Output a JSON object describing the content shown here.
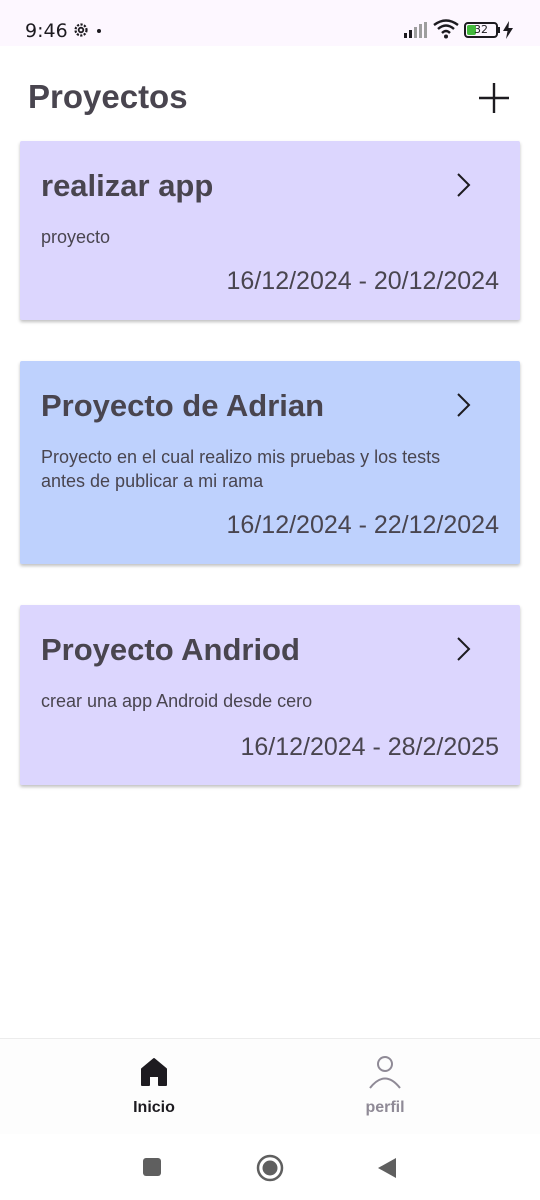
{
  "status_bar": {
    "time": "9:46",
    "battery_level": "32",
    "battery_color": "#43b93c"
  },
  "header": {
    "title": "Proyectos",
    "add_icon": "plus-icon"
  },
  "projects": [
    {
      "title": "realizar app",
      "description": "proyecto",
      "dates": "16/12/2024 - 20/12/2024",
      "color": "#dcd6fe"
    },
    {
      "title": "Proyecto de Adrian",
      "description": "Proyecto en el cual realizo mis pruebas y los tests antes de publicar a mi rama",
      "dates": "16/12/2024 - 22/12/2024",
      "color": "#bed1fd"
    },
    {
      "title": "Proyecto Andriod",
      "description": "crear una app Android desde cero",
      "dates": "16/12/2024 - 28/2/2025",
      "color": "#dcd6fe"
    }
  ],
  "bottom_nav": {
    "items": [
      {
        "label": "Inicio",
        "icon": "home-icon",
        "selected": true,
        "color": "#1d1b20"
      },
      {
        "label": "perfil",
        "icon": "person-icon",
        "selected": false,
        "color": "#8f8a96"
      }
    ]
  },
  "system_nav": {
    "recents_icon": "square-icon",
    "home_icon": "circle-home-icon",
    "back_icon": "back-triangle-icon"
  }
}
